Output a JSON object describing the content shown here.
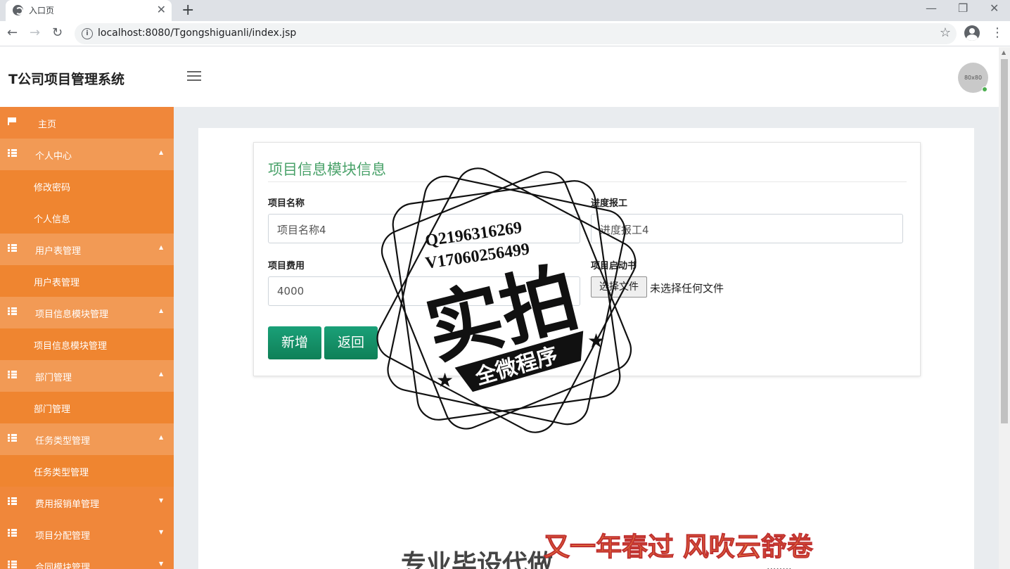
{
  "browser": {
    "tab_title": "入口页",
    "new_tab": "+",
    "tab_close": "✕",
    "url": "localhost:8080/Tgongshiguanli/index.jsp",
    "window_controls": [
      "—",
      "❐",
      "✕"
    ]
  },
  "header": {
    "brand": "T公司项目管理系统",
    "avatar_text": "80x80"
  },
  "sidebar": {
    "items": [
      {
        "label": "主页",
        "type": "home",
        "icon": "flag-icon"
      },
      {
        "label": "个人中心",
        "type": "group",
        "icon": "grid-icon",
        "caret": "▲"
      },
      {
        "label": "修改密码",
        "type": "sub"
      },
      {
        "label": "个人信息",
        "type": "sub"
      },
      {
        "label": "用户表管理",
        "type": "group",
        "icon": "grid-icon",
        "caret": "▲"
      },
      {
        "label": "用户表管理",
        "type": "sub"
      },
      {
        "label": "项目信息模块管理",
        "type": "group",
        "icon": "grid-icon",
        "caret": "▲"
      },
      {
        "label": "项目信息模块管理",
        "type": "sub"
      },
      {
        "label": "部门管理",
        "type": "group",
        "icon": "grid-icon",
        "caret": "▲"
      },
      {
        "label": "部门管理",
        "type": "sub"
      },
      {
        "label": "任务类型管理",
        "type": "group",
        "icon": "grid-icon",
        "caret": "▲"
      },
      {
        "label": "任务类型管理",
        "type": "sub"
      },
      {
        "label": "费用报销单管理",
        "type": "group",
        "icon": "grid-icon",
        "caret": "▼"
      },
      {
        "label": "项目分配管理",
        "type": "group",
        "icon": "grid-icon",
        "caret": "▼"
      },
      {
        "label": "合同模块管理",
        "type": "group",
        "icon": "grid-icon",
        "caret": "▼"
      }
    ]
  },
  "form": {
    "title": "项目信息模块信息",
    "project_name_label": "项目名称",
    "project_name_value": "项目名称4",
    "progress_label": "进度报工",
    "progress_value": "进度报工4",
    "cost_label": "项目费用",
    "cost_value": "4000",
    "kickoff_label": "项目启动书",
    "file_button": "选择文件",
    "file_status": "未选择任何文件",
    "add_button": "新增",
    "back_button": "返回"
  },
  "watermark": {
    "qq": "Q2196316269",
    "phone": "V17060256499",
    "big": "实拍",
    "banner": "全微程序",
    "poem": "又一年春过 风吹云舒卷",
    "bottom": "专业毕设代做",
    "bottom_right": "........"
  }
}
